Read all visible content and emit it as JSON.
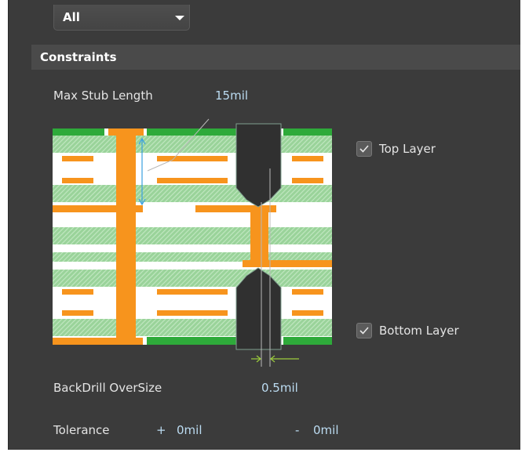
{
  "filter": {
    "selected": "All",
    "arrow_icon": "triangle-down-icon"
  },
  "section": {
    "title": "Constraints"
  },
  "max_stub": {
    "label": "Max Stub Length",
    "value": "15mil"
  },
  "layers": {
    "top": {
      "label": "Top Layer",
      "checked": true
    },
    "bottom": {
      "label": "Bottom Layer",
      "checked": true
    }
  },
  "backdrill": {
    "label": "BackDrill OverSize",
    "value": "0.5mil"
  },
  "tolerance": {
    "label": "Tolerance",
    "plus_sign": "+",
    "plus_value": "0mil",
    "minus_sign": "-",
    "minus_value": "0mil"
  },
  "colors": {
    "panel_bg": "#3b3b3b",
    "copper": "#f7941d",
    "dielectric": "#9ad39a",
    "solder_mask": "#2eaa3a",
    "drill": "#303030",
    "value_text": "#bcdcf2",
    "dimension_line": "#3aa0e0"
  }
}
